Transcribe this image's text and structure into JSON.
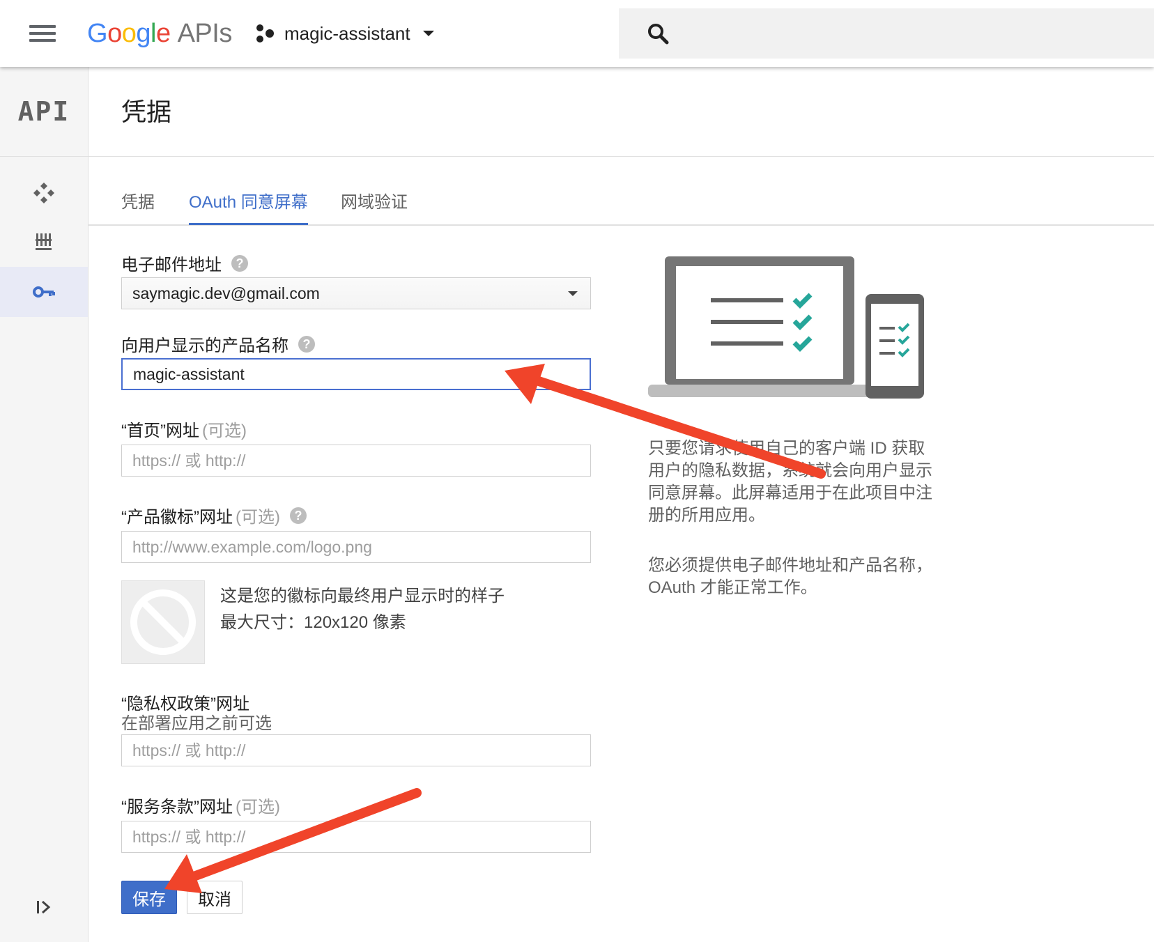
{
  "header": {
    "logo": {
      "letters": [
        "G",
        "o",
        "o",
        "g",
        "l",
        "e"
      ],
      "suffix": "APIs"
    },
    "project_name": "magic-assistant",
    "search_placeholder": ""
  },
  "rail": {
    "head_label": "API",
    "items": [
      {
        "icon": "dashboard-icon"
      },
      {
        "icon": "library-icon"
      },
      {
        "icon": "key-icon",
        "active": true
      }
    ],
    "expand_icon": "expand-icon"
  },
  "page": {
    "title": "凭据"
  },
  "tabs": [
    {
      "label": "凭据",
      "active": false
    },
    {
      "label": "OAuth 同意屏幕",
      "active": true
    },
    {
      "label": "网域验证",
      "active": false
    }
  ],
  "form": {
    "email": {
      "label": "电子邮件地址",
      "value": "saymagic.dev@gmail.com"
    },
    "product_name": {
      "label": "向用户显示的产品名称",
      "value": "magic-assistant"
    },
    "homepage": {
      "label": "“首页”网址",
      "optional": "(可选)",
      "placeholder": "https:// 或 http://"
    },
    "logo_url": {
      "label": "“产品徽标”网址",
      "optional": "(可选)",
      "placeholder": "http://www.example.com/logo.png"
    },
    "logo_preview": {
      "note_line1": "这是您的徽标向最终用户显示时的样子",
      "note_line2": "最大尺寸：120x120 像素"
    },
    "privacy": {
      "label": "“隐私权政策”网址",
      "sublabel": "在部署应用之前可选",
      "placeholder": "https:// 或 http://"
    },
    "terms": {
      "label": "“服务条款”网址",
      "optional": "(可选)",
      "placeholder": "https:// 或 http://"
    },
    "save_label": "保存",
    "cancel_label": "取消"
  },
  "info": {
    "para1": "只要您请求使用自己的客户端 ID 获取用户的隐私数据，系统就会向用户显示同意屏幕。此屏幕适用于在此项目中注册的所用应用。",
    "para2": "您必须提供电子邮件地址和产品名称，OAuth 才能正常工作。"
  },
  "colors": {
    "accent": "#3f6ec9",
    "check": "#26a69a",
    "arrow": "#f0442a"
  }
}
